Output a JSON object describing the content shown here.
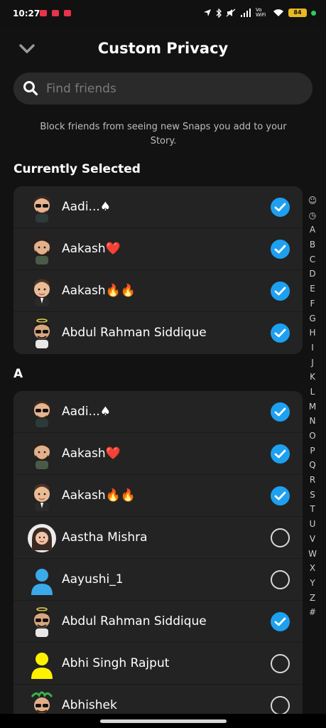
{
  "status_bar": {
    "time": "10:27",
    "battery": "84",
    "network_label": "Vo WiFi"
  },
  "header": {
    "title": "Custom Privacy",
    "back_icon": "chevron-down-icon"
  },
  "search": {
    "placeholder": "Find friends",
    "value": ""
  },
  "description": "Block friends from seeing new Snaps you add to your Story.",
  "sections": {
    "selected_title": "Currently Selected",
    "a_title": "A"
  },
  "selected": [
    {
      "name": "Aadi...♠",
      "checked": true
    },
    {
      "name": "Aakash❤️",
      "checked": true
    },
    {
      "name": "Aakash🔥🔥",
      "checked": true
    },
    {
      "name": "Abdul Rahman Siddique",
      "checked": true
    }
  ],
  "friends_a": [
    {
      "name": "Aadi...♠",
      "checked": true
    },
    {
      "name": "Aakash❤️",
      "checked": true
    },
    {
      "name": "Aakash🔥🔥",
      "checked": true
    },
    {
      "name": "Aastha Mishra",
      "checked": false
    },
    {
      "name": "Aayushi_1",
      "checked": false
    },
    {
      "name": "Abdul Rahman Siddique",
      "checked": true
    },
    {
      "name": "Abhi Singh  Rajput",
      "checked": false
    },
    {
      "name": "Abhishek",
      "checked": false
    }
  ],
  "alphabet": [
    "☺",
    "◷",
    "A",
    "B",
    "C",
    "D",
    "E",
    "F",
    "G",
    "H",
    "I",
    "J",
    "K",
    "L",
    "M",
    "N",
    "O",
    "P",
    "Q",
    "R",
    "S",
    "T",
    "U",
    "V",
    "W",
    "X",
    "Y",
    "Z",
    "#"
  ],
  "colors": {
    "background": "#121212",
    "card": "#232323",
    "accent_check": "#1ea0f0"
  }
}
